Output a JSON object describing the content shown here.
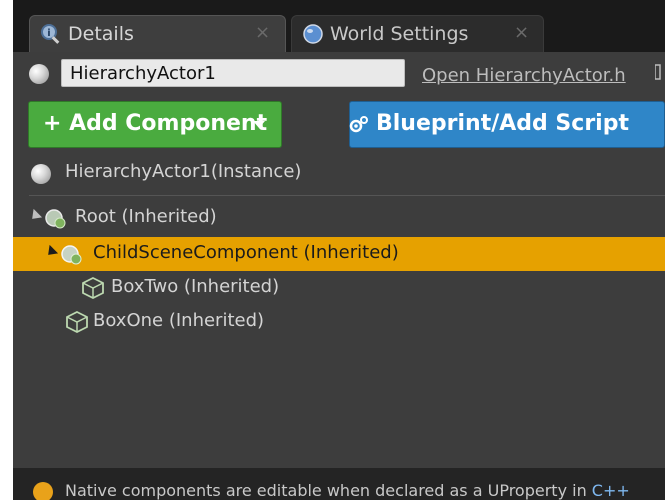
{
  "tabs": [
    {
      "label": "Details",
      "close": "×"
    },
    {
      "label": "World Settings",
      "close": "×"
    }
  ],
  "actor": {
    "name_value": "HierarchyActor1",
    "open_link": "Open HierarchyActor.h"
  },
  "toolbar": {
    "add_component_label": "+ Add Component",
    "blueprint_label": "Blueprint/Add Script"
  },
  "instance_label": "HierarchyActor1(Instance)",
  "tree": [
    {
      "label": "Root (Inherited)"
    },
    {
      "label": "ChildSceneComponent (Inherited)"
    },
    {
      "label": "BoxTwo (Inherited)"
    },
    {
      "label": "BoxOne (Inherited)"
    }
  ],
  "footer": {
    "text": "Native components are editable when declared as a UProperty in",
    "cpp": "C++"
  },
  "colors": {
    "add_button": "#4aab3f",
    "blueprint_button": "#2f86c8",
    "selection": "#e6a100",
    "panel": "#3d3d3d"
  },
  "icons": [
    "details-icon",
    "world-icon",
    "actor-sphere-icon",
    "scene-component-icon",
    "box-component-icon",
    "gear-icon",
    "warning-icon",
    "chevron-down-icon"
  ]
}
